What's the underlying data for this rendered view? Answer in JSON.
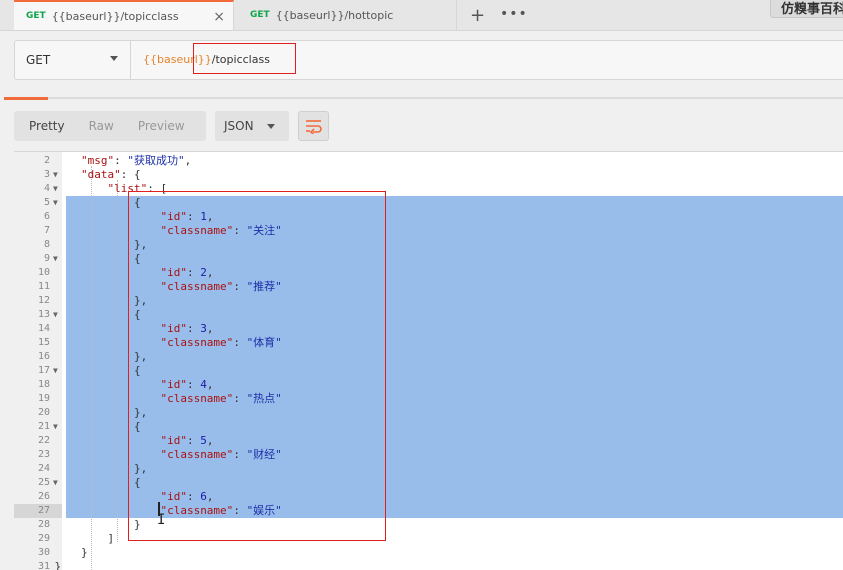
{
  "tabs": [
    {
      "method": "GET",
      "title": "{{baseurl}}/topicclass",
      "close": "×"
    },
    {
      "method": "GET",
      "title": "{{baseurl}}/hottopic"
    }
  ],
  "tabbar": {
    "plus": "+",
    "more": "•••",
    "env": "仿糗事百科"
  },
  "request": {
    "method": "GET",
    "url_var": "{{baseurl}}",
    "url_path": "/topicclass"
  },
  "toolbar": {
    "pretty": "Pretty",
    "raw": "Raw",
    "preview": "Preview",
    "format": "JSON"
  },
  "icons": {
    "close": "close-icon",
    "plus": "plus-icon",
    "more": "more-icon",
    "chevron": "chevron-down-icon",
    "wrap": "wrap-lines-icon",
    "fold": "fold-arrow-icon"
  },
  "colors": {
    "accent": "#f26b3a",
    "selection": "#99bdeb",
    "highlight_box": "#e02020",
    "url_var": "#e8832a"
  },
  "code_lines": [
    {
      "n": "2",
      "fold": false,
      "text": "        \"msg\": \"获取成功\","
    },
    {
      "n": "3",
      "fold": true,
      "text": "        \"data\": {"
    },
    {
      "n": "4",
      "fold": true,
      "text": "            \"list\": ["
    },
    {
      "n": "5",
      "fold": true,
      "text": "                {"
    },
    {
      "n": "6",
      "fold": false,
      "text": "                    \"id\": 1,"
    },
    {
      "n": "7",
      "fold": false,
      "text": "                    \"classname\": \"关注\""
    },
    {
      "n": "8",
      "fold": false,
      "text": "                },"
    },
    {
      "n": "9",
      "fold": true,
      "text": "                {"
    },
    {
      "n": "10",
      "fold": false,
      "text": "                    \"id\": 2,"
    },
    {
      "n": "11",
      "fold": false,
      "text": "                    \"classname\": \"推荐\""
    },
    {
      "n": "12",
      "fold": false,
      "text": "                },"
    },
    {
      "n": "13",
      "fold": true,
      "text": "                {"
    },
    {
      "n": "14",
      "fold": false,
      "text": "                    \"id\": 3,"
    },
    {
      "n": "15",
      "fold": false,
      "text": "                    \"classname\": \"体育\""
    },
    {
      "n": "16",
      "fold": false,
      "text": "                },"
    },
    {
      "n": "17",
      "fold": true,
      "text": "                {"
    },
    {
      "n": "18",
      "fold": false,
      "text": "                    \"id\": 4,"
    },
    {
      "n": "19",
      "fold": false,
      "text": "                    \"classname\": \"热点\""
    },
    {
      "n": "20",
      "fold": false,
      "text": "                },"
    },
    {
      "n": "21",
      "fold": true,
      "text": "                {"
    },
    {
      "n": "22",
      "fold": false,
      "text": "                    \"id\": 5,"
    },
    {
      "n": "23",
      "fold": false,
      "text": "                    \"classname\": \"财经\""
    },
    {
      "n": "24",
      "fold": false,
      "text": "                },"
    },
    {
      "n": "25",
      "fold": true,
      "text": "                {"
    },
    {
      "n": "26",
      "fold": false,
      "text": "                    \"id\": 6,"
    },
    {
      "n": "27",
      "fold": false,
      "text": "                    \"classname\": \"娱乐\""
    },
    {
      "n": "28",
      "fold": false,
      "text": "                }"
    },
    {
      "n": "29",
      "fold": false,
      "text": "            ]"
    },
    {
      "n": "30",
      "fold": false,
      "text": "        }"
    },
    {
      "n": "31",
      "fold": false,
      "text": "    }"
    }
  ]
}
